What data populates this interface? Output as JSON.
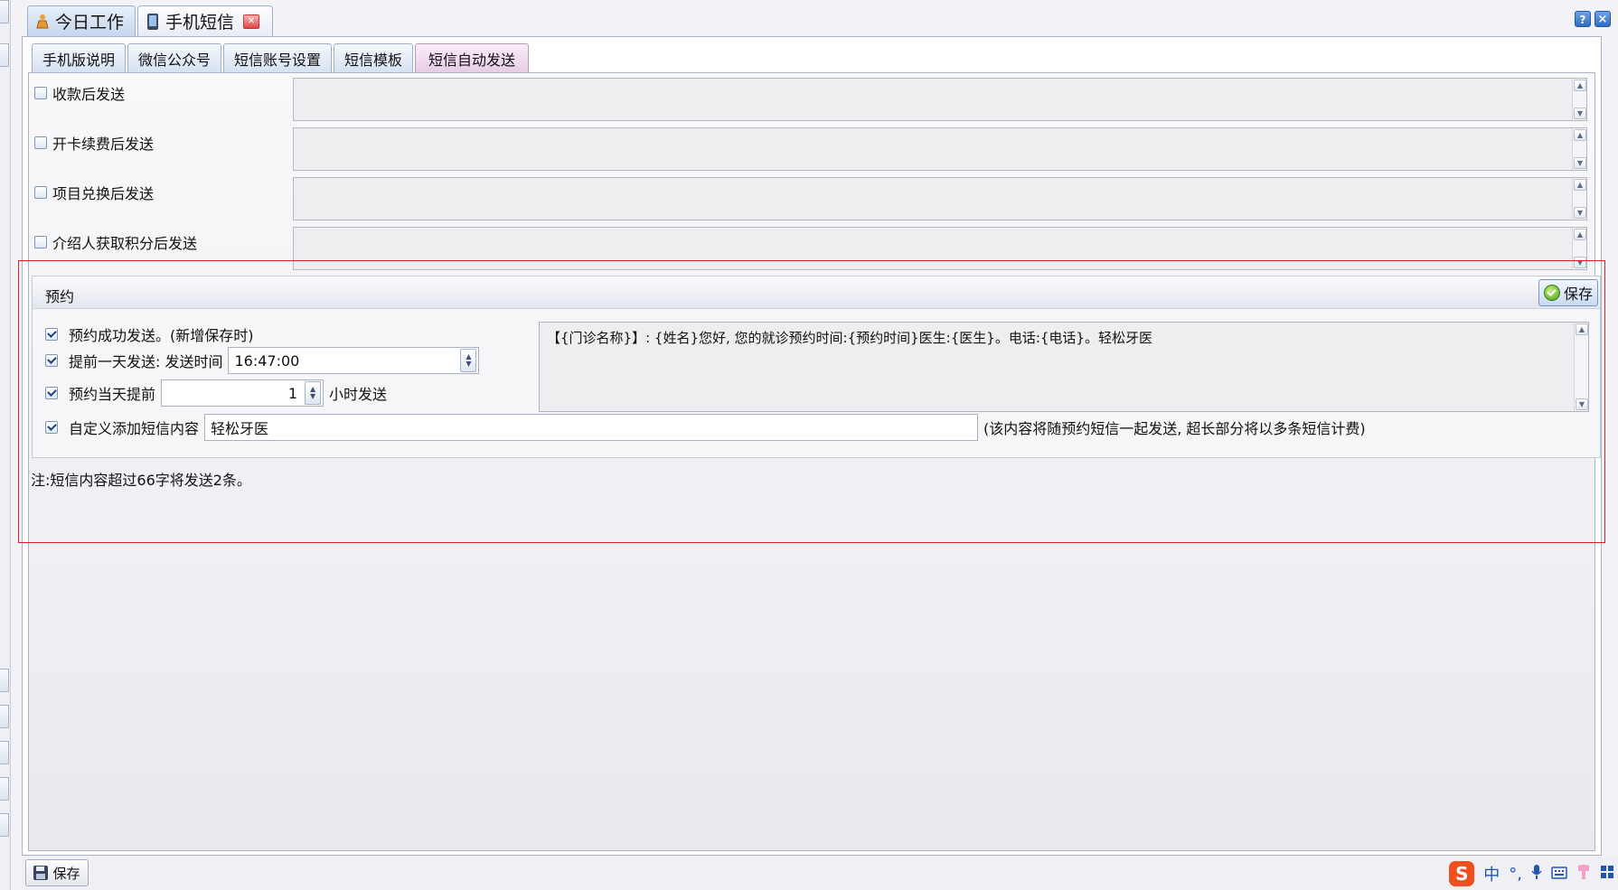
{
  "top_tabs": [
    {
      "label": "今日工作",
      "icon": "work-icon"
    },
    {
      "label": "手机短信",
      "icon": "phone-icon"
    }
  ],
  "sub_tabs": [
    {
      "label": "手机版说明"
    },
    {
      "label": "微信公众号"
    },
    {
      "label": "短信账号设置"
    },
    {
      "label": "短信模板"
    },
    {
      "label": "短信自动发送"
    }
  ],
  "sections": [
    {
      "label": "收款后发送",
      "checked": false,
      "text": ""
    },
    {
      "label": "开卡续费后发送",
      "checked": false,
      "text": ""
    },
    {
      "label": "项目兑换后发送",
      "checked": false,
      "text": ""
    },
    {
      "label": "介绍人获取积分后发送",
      "checked": false,
      "text": ""
    }
  ],
  "booking": {
    "title": "预约",
    "save_label": "保存",
    "success_label": "预约成功发送。(新增保存时)",
    "day_before_label": "提前一天发送: 发送时间",
    "send_time": "16:47:00",
    "same_day_label": "预约当天提前",
    "hours_value": "1",
    "hours_suffix": "小时发送",
    "custom_label": "自定义添加短信内容",
    "custom_value": "轻松牙医",
    "custom_hint": "(该内容将随预约短信一起发送, 超长部分将以多条短信计费)",
    "template_text": "【{门诊名称}】: {姓名}您好, 您的就诊预约时间:{预约时间}医生:{医生}。电话:{电话}。轻松牙医"
  },
  "note": "注:短信内容超过66字将发送2条。",
  "bottom_save_label": "保存",
  "ime": {
    "lang": "中",
    "punct": "°,"
  }
}
